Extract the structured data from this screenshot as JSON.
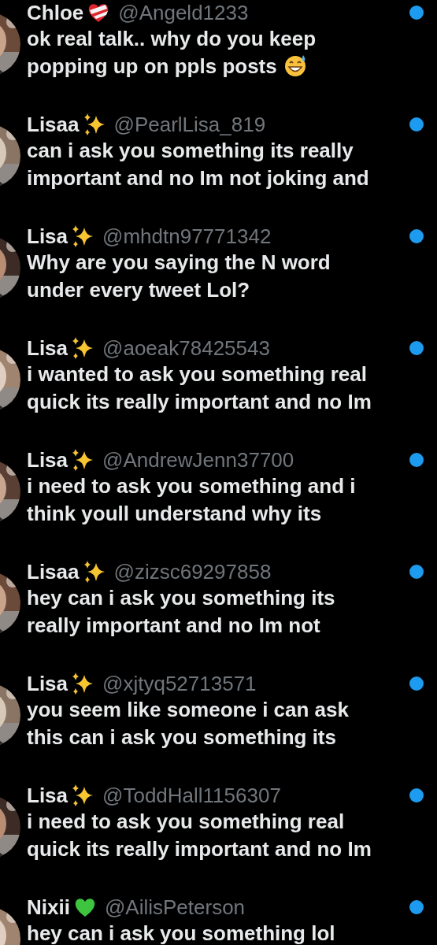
{
  "conversations": [
    {
      "name": "Chloe",
      "name_badge": {
        "kind": "bandaged-heart"
      },
      "handle": "@Angeld1233",
      "message": "ok real talk.. why do you keep popping up on ppls posts",
      "message_badge": {
        "kind": "sweat-smile"
      },
      "unread": true
    },
    {
      "name": "Lisaa",
      "name_badge": {
        "kind": "sparkles"
      },
      "handle": "@PearlLisa_819",
      "message": "can i ask you something its really important and no Im not joking and",
      "unread": true
    },
    {
      "name": "Lisa",
      "name_badge": {
        "kind": "sparkles"
      },
      "handle": "@mhdtn97771342",
      "message": "Why are you saying the N word under every tweet Lol?",
      "unread": true
    },
    {
      "name": "Lisa",
      "name_badge": {
        "kind": "sparkles"
      },
      "handle": "@aoeak78425543",
      "message": "i wanted to ask you something real quick its really important and no Im",
      "unread": true
    },
    {
      "name": "Lisa",
      "name_badge": {
        "kind": "sparkles"
      },
      "handle": "@AndrewJenn37700",
      "message": "i need to ask you something and i think youll understand why its",
      "unread": true
    },
    {
      "name": "Lisaa",
      "name_badge": {
        "kind": "sparkles"
      },
      "handle": "@zizsc69297858",
      "message": "hey can i ask you something its really important and no Im not",
      "unread": true
    },
    {
      "name": "Lisa",
      "name_badge": {
        "kind": "sparkles"
      },
      "handle": "@xjtyq52713571",
      "message": "you seem like someone i can ask this can i ask you something its",
      "unread": true
    },
    {
      "name": "Lisa",
      "name_badge": {
        "kind": "sparkles"
      },
      "handle": "@ToddHall1156307",
      "message": "i need to ask you something real quick its really important and no Im",
      "unread": true
    },
    {
      "name": "Nixii",
      "name_badge": {
        "kind": "leaf-heart"
      },
      "handle": "@AilisPeterson",
      "message": "hey can i ask you something lol",
      "unread": true
    }
  ]
}
